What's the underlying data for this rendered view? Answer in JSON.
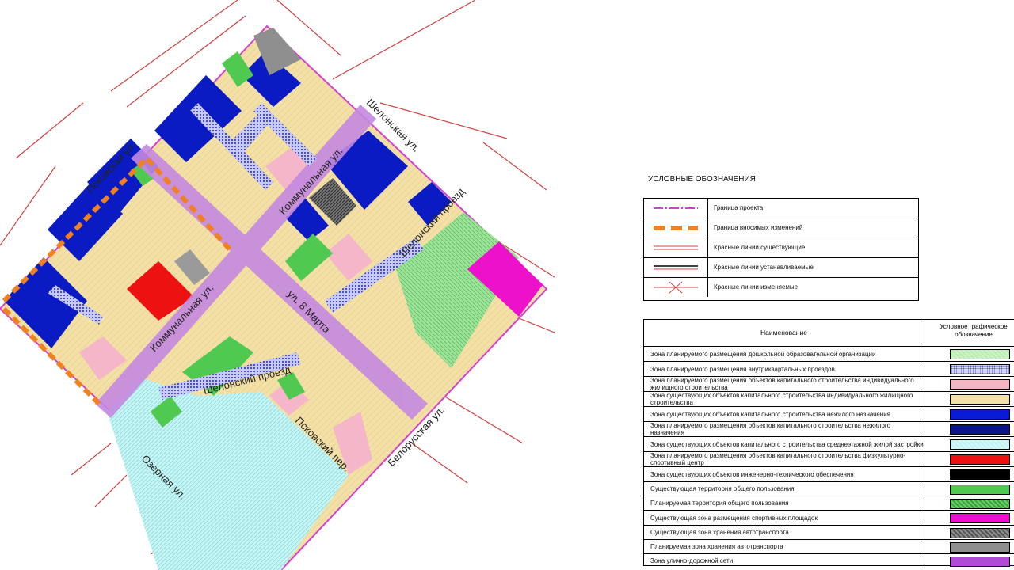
{
  "streets": {
    "pskovskaya": "Псковская ул.",
    "shelonskaya": "Шелонская ул.",
    "kommunalnaya_top": "Коммунальная ул.",
    "kommunalnaya_bottom": "Коммунальная ул.",
    "shelonsky_proezd_right": "Шелонский проезд",
    "shelonsky_proezd_bottom": "Шелонский проезд",
    "march8": "ул. 8 Марта",
    "pskovsky_per": "Псковский пер.",
    "belorusskaya": "Белорусская ул.",
    "ozernaya": "Озерная ул."
  },
  "legend": {
    "title": "УСЛОВНЫЕ ОБОЗНАЧЕНИЯ",
    "items": [
      {
        "label": "Граница проекта",
        "icon": "magenta-dash-line-icon"
      },
      {
        "label": "Граница вносимых изменений",
        "icon": "orange-dash-line-icon"
      },
      {
        "label": "Красные линии существующие",
        "icon": "red-double-line-icon"
      },
      {
        "label": "Красные линии устанавливаемые",
        "icon": "black-red-double-line-icon"
      },
      {
        "label": "Красные линии изменяемые",
        "icon": "red-cross-line-icon"
      }
    ]
  },
  "zones": {
    "header_name": "Наименование",
    "header_symbol": "Условное графическое обозначение",
    "rows": [
      {
        "label": "Зона планируемого размещения дошкольной образовательной организации",
        "color": "#b8ecb0",
        "pattern": "hatch"
      },
      {
        "label": "Зона планируемого размещения внутриквартальных проездов",
        "color": "#5a5fd6",
        "pattern": "dots"
      },
      {
        "label": "Зона планируемого размещения объектов капитального строительства индивидуального жилищного строительства",
        "color": "#f4b6c2",
        "pattern": "solid"
      },
      {
        "label": "Зона существующих объектов капитального строительства индивидуального жилищного строительства",
        "color": "#f4e1a8",
        "pattern": "solid"
      },
      {
        "label": "Зона существующих объектов капитального строительства нежилого назначения",
        "color": "#0a1bd6",
        "pattern": "solid"
      },
      {
        "label": "Зона планируемого размещения объектов капитального строительства нежилого назначения",
        "color": "#0b158a",
        "pattern": "solid"
      },
      {
        "label": "Зона существующих объектов капитального строительства среднеэтажной жилой застройки",
        "color": "#bff3f3",
        "pattern": "hatch"
      },
      {
        "label": "Зона планируемого размещения объектов капитального строительства физкультурно-спортивный центр",
        "color": "#ee1111",
        "pattern": "solid"
      },
      {
        "label": "Зона существующих объектов инженерно-технического обеспечения",
        "color": "#000000",
        "pattern": "solid"
      },
      {
        "label": "Существующая территория общего пользования",
        "color": "#4fc94f",
        "pattern": "solid"
      },
      {
        "label": "Планируемая территория общего пользования",
        "color": "#2ea82e",
        "pattern": "hatch"
      },
      {
        "label": "Существующая зона размещения спортивных площадок",
        "color": "#ee11cc",
        "pattern": "solid"
      },
      {
        "label": "Существующая зона хранения автотранспорта",
        "color": "#555555",
        "pattern": "hatch"
      },
      {
        "label": "Планируемая зона хранения автотранспорта",
        "color": "#8f8f8f",
        "pattern": "solid"
      },
      {
        "label": "Зона улично-дорожной сети",
        "color": "#b04bd6",
        "pattern": "solid"
      }
    ]
  }
}
